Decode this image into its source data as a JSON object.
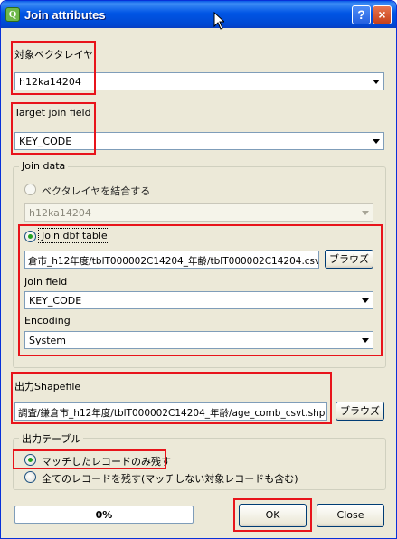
{
  "window": {
    "title": "Join attributes",
    "help_label": "?",
    "close_label": "×",
    "app_icon": "Q"
  },
  "target_layer": {
    "label": "対象ベクタレイヤ",
    "value": "h12ka14204"
  },
  "target_join_field": {
    "label": "Target join field",
    "value": "KEY_CODE"
  },
  "join_data": {
    "group_title": "Join data",
    "vector_option": {
      "label": "ベクタレイヤを結合する",
      "selected": false
    },
    "vector_layer_value": "h12ka14204",
    "dbf_option": {
      "label": "Join dbf table",
      "selected": true
    },
    "dbf_path": "倉市_h12年度/tblT000002C14204_年齢/tblT000002C14204.csv",
    "browse_label": "ブラウズ",
    "join_field": {
      "label": "Join field",
      "value": "KEY_CODE"
    },
    "encoding": {
      "label": "Encoding",
      "value": "System"
    }
  },
  "output_shapefile": {
    "label": "出力Shapefile",
    "path": "調査/鎌倉市_h12年度/tblT000002C14204_年齢/age_comb_csvt.shp",
    "browse_label": "ブラウズ"
  },
  "output_table": {
    "group_title": "出力テーブル",
    "option_matched": {
      "label": "マッチしたレコードのみ残す",
      "selected": true
    },
    "option_all": {
      "label": "全てのレコードを残す(マッチしない対象レコードも含む)",
      "selected": false
    }
  },
  "progress": {
    "percent_label": "0%",
    "value": 0
  },
  "buttons": {
    "ok_label": "OK",
    "close_label": "Close"
  },
  "colors": {
    "title_bar": "#0055e5",
    "dialog_bg": "#ece9d8",
    "highlight_red": "#e8141b",
    "progress_green": "#2eb12e"
  }
}
